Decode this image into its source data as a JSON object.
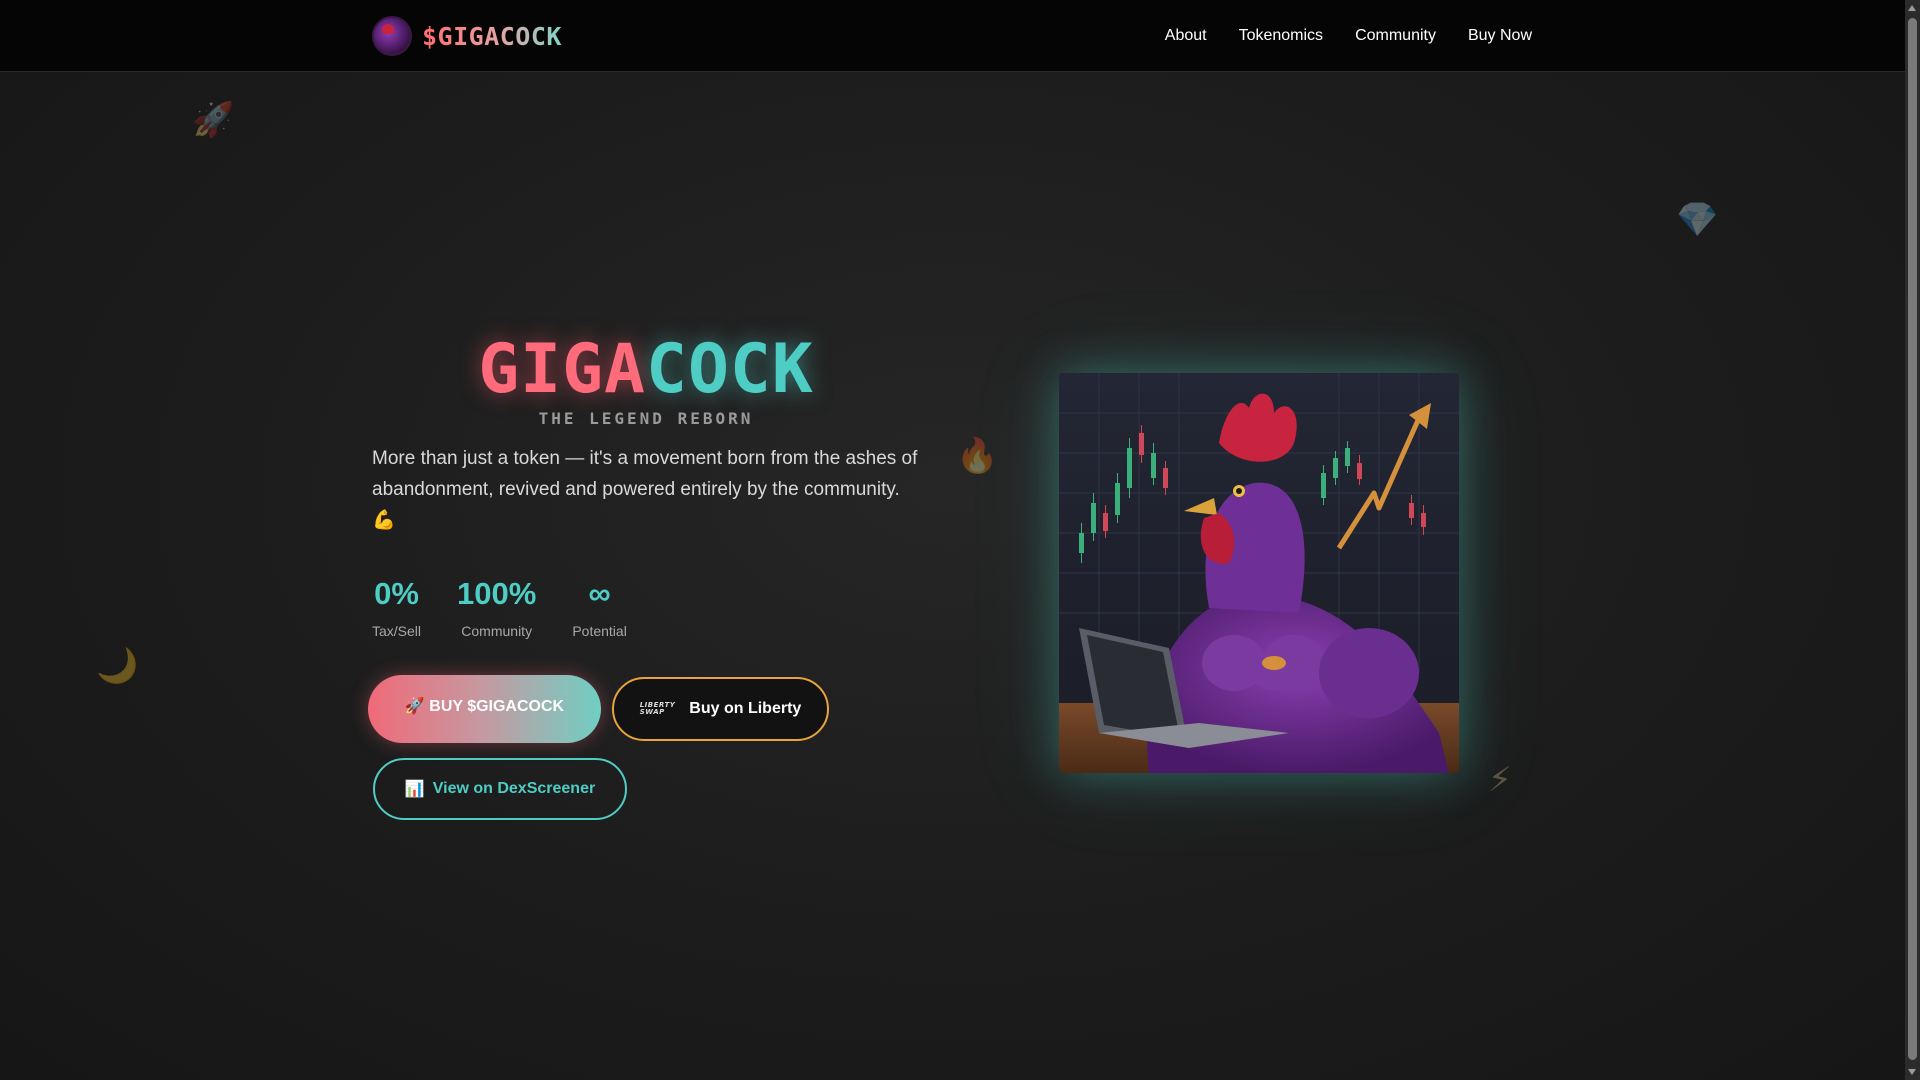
{
  "header": {
    "logo_text": "$GIGACOCK",
    "nav": [
      "About",
      "Tokenomics",
      "Community",
      "Buy Now"
    ]
  },
  "decorations": {
    "rocket": "🚀",
    "diamond": "💎",
    "fire": "🔥",
    "moon": "🌙",
    "lightning": "⚡"
  },
  "hero": {
    "title_part1": "GIGA",
    "title_part2": "COCK",
    "subtitle": "THE LEGEND REBORN",
    "description": "More than just a token — it's a movement born from the ashes of abandonment, revived and powered entirely by the community. 💪",
    "stats": [
      {
        "value": "0%",
        "label": "Tax/Sell"
      },
      {
        "value": "100%",
        "label": "Community"
      },
      {
        "value": "∞",
        "label": "Potential"
      }
    ],
    "buttons": {
      "buy": "🚀 BUY $GIGACOCK",
      "liberty": "Buy on Liberty",
      "liberty_logo_line1": "LIBERTY",
      "liberty_logo_line2": "SWAP",
      "dex_icon": "📊",
      "dex": "View on DexScreener"
    }
  },
  "colors": {
    "accent_red": "#ff6b7a",
    "accent_teal": "#4ecdc4",
    "accent_orange": "#e8a33b",
    "background": "#1b1b1b",
    "header_bg": "#050505"
  },
  "icons": {
    "logo": "purple-rooster-coin-icon",
    "liberty": "liberty-swap-logo-icon",
    "dex": "bar-chart-icon"
  }
}
